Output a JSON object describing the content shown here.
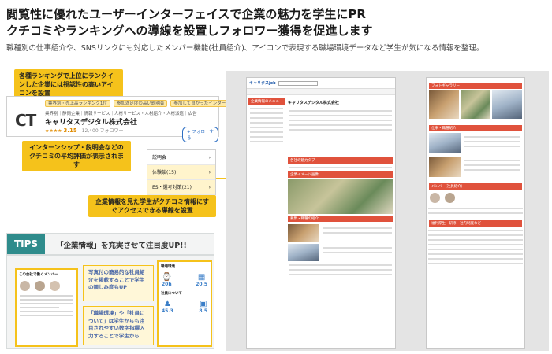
{
  "headline": {
    "line1": "閲覧性に優れたユーザーインターフェイスで企業の魅力を学生にPR",
    "line2": "クチコミやランキングへの導線を設置しフォロワー獲得を促進します",
    "sub": "職種別の仕事紹介や、SNSリンクにも対応したメンバー機能(社員紹介)、アイコンで表現する職場環境データなど学生が気になる情報を整理。"
  },
  "callouts": {
    "ranking": "各種ランキングで上位にランクインした企業には視認性の高いアイコンを設置",
    "reviews": "インターンシップ・説明会などのクチコミの平均評価が表示されます",
    "navigation": "企業情報を見た学生がクチコミ情報にすぐアクセスできる導線を設置"
  },
  "company_card": {
    "logo": "CT",
    "badges": [
      "業界別・売上高ランキング1位",
      "参加満足度の高い説明会",
      "参加して良かったインターンシップ"
    ],
    "industry": "業界別｜静岡企業｜情報サービス｜人材サービス・人材紹介・人材派遣｜広告",
    "name": "キャリタスデジタル株式会社",
    "rating_stars": "★★★★",
    "rating_value": "3.15",
    "follow_count": "12,400 フォロワー",
    "follow_button": "+ フォローする"
  },
  "menu_card": {
    "items": [
      {
        "label": "説明会",
        "arrow": "›"
      },
      {
        "label": "体験談(15)",
        "arrow": "›"
      },
      {
        "label": "ES・選考対策(21)",
        "arrow": "›"
      }
    ]
  },
  "tips": {
    "label": "TIPS",
    "text": "「企業情報」を充実させて注目度UP!!",
    "note1": "写真付の簡易的な社員紹介を掲載することで学生の親しみ度もUP",
    "note2": "「職場環境」や「社員について」は学生からも注目されやすい数字指標入力することで学生から",
    "member_card_title": "この会社で働くメンバー",
    "env_card_title": "職場環境",
    "employee_title": "社員について",
    "stats": [
      {
        "icon": "⌚",
        "value": "20h"
      },
      {
        "icon": "▦",
        "value": "20.5"
      },
      {
        "icon": "♟",
        "value": "45.3"
      },
      {
        "icon": "▣",
        "value": "8.5"
      }
    ]
  },
  "webpage": {
    "logo": "キャリタスjob",
    "side_tag": "企業情報のメニュー",
    "sec_follow": "各社の魅力タブ",
    "sec_image": "企業イメージ画像",
    "sec_job": "募集・職種の紹介",
    "company_name": "キャリタスデジタル株式会社"
  },
  "rightpage": {
    "gallery": "フォトギャラリー",
    "job": "仕事・職種紹介",
    "members": "メンバー(社員紹介)",
    "welfare": "福利厚生・研修・社内制度など"
  }
}
